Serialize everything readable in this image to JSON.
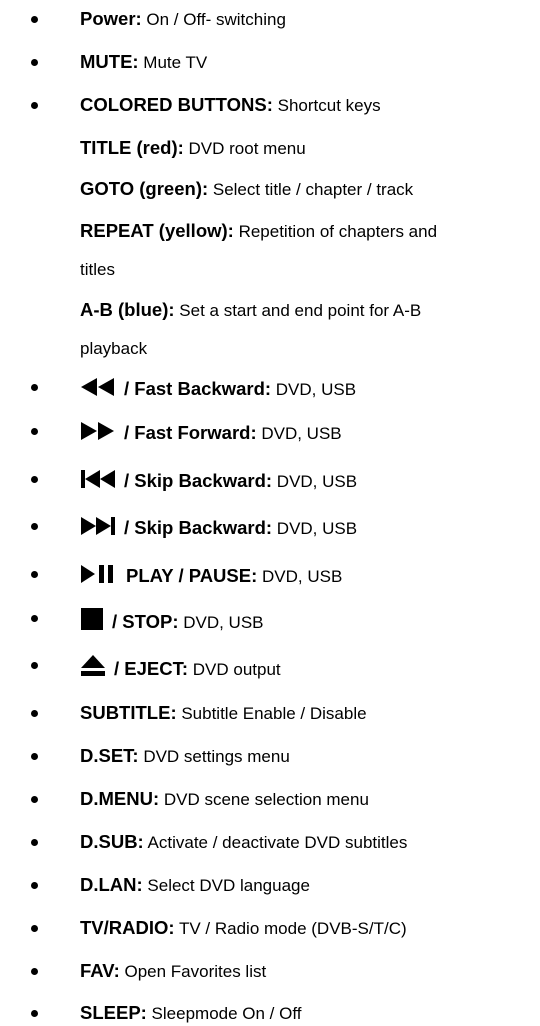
{
  "items": [
    {
      "term": "Power:",
      "desc": " On / Off- switching"
    },
    {
      "term": "MUTE:",
      "desc": " Mute TV"
    },
    {
      "term": "COLORED BUTTONS:",
      "desc": " Shortcut keys"
    },
    {
      "term": "TITLE (red):",
      "desc": " DVD root menu"
    },
    {
      "term": "GOTO (green):",
      "desc": " Select title / chapter / track"
    },
    {
      "term": "REPEAT (yellow):",
      "desc": " Repetition of chapters and",
      "desc2": "titles"
    },
    {
      "term": "A-B (blue):",
      "desc": " Set a start and end point for A-B",
      "desc2": "playback"
    },
    {
      "icon": "fast-backward-icon",
      "term": "/ Fast Backward:",
      "desc": " DVD, USB"
    },
    {
      "icon": "fast-forward-icon",
      "term": "/ Fast Forward:",
      "desc": " DVD, USB"
    },
    {
      "icon": "skip-backward-icon",
      "term": "/ Skip Backward:",
      "desc": " DVD, USB"
    },
    {
      "icon": "skip-forward-icon",
      "term": "/ Skip Backward:",
      "desc": " DVD, USB"
    },
    {
      "icon": "play-pause-icon",
      "term": "PLAY / PAUSE:",
      "desc": " DVD, USB"
    },
    {
      "icon": "stop-icon",
      "term": "/ STOP:",
      "desc": " DVD, USB"
    },
    {
      "icon": "eject-icon",
      "term": "/ EJECT:",
      "desc": " DVD output"
    },
    {
      "term": "SUBTITLE:",
      "desc": " Subtitle Enable / Disable"
    },
    {
      "term": "D.SET:",
      "desc": " DVD settings menu"
    },
    {
      "term": "D.MENU:",
      "desc": " DVD scene selection menu"
    },
    {
      "term": "D.SUB:",
      "desc": " Activate / deactivate DVD subtitles"
    },
    {
      "term": "D.LAN:",
      "desc": " Select DVD language"
    },
    {
      "term": "TV/RADIO:",
      "desc": " TV / Radio mode (DVB-S/T/C)"
    },
    {
      "term": "FAV:",
      "desc": " Open Favorites list"
    },
    {
      "term": "SLEEP:",
      "desc": " Sleepmode On / Off"
    }
  ]
}
